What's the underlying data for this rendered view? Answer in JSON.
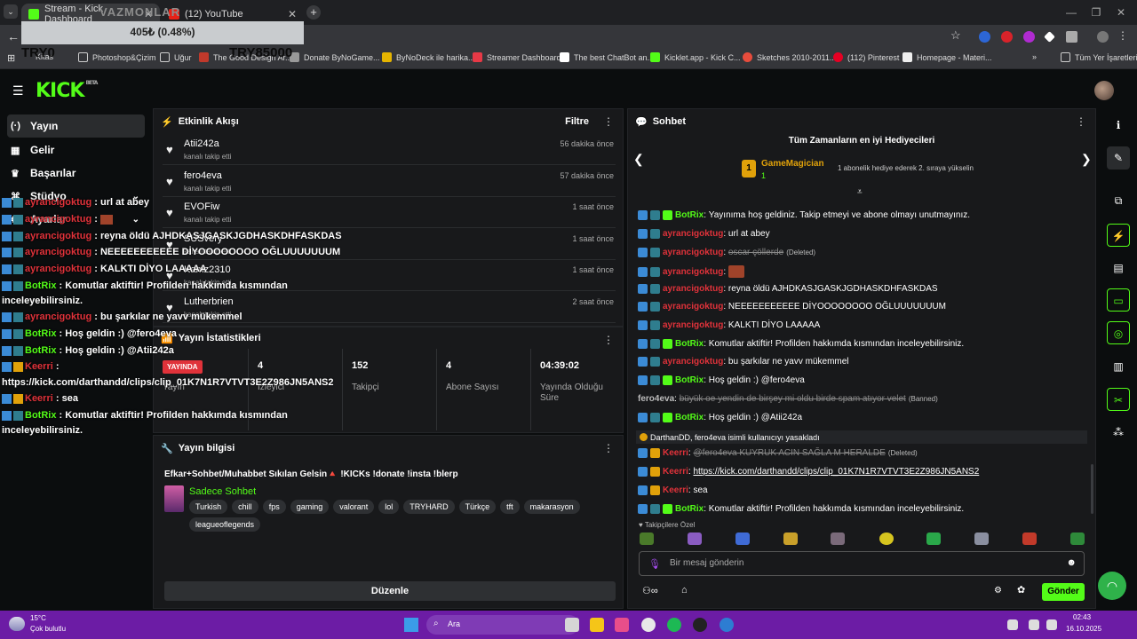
{
  "browser": {
    "tabs": [
      {
        "label": "Stream - Kick Dashboard",
        "close": "✕"
      },
      {
        "label": "(12) YouTube",
        "close": "✕"
      }
    ],
    "new_tab": "+",
    "bookmarks": [
      "Kitas",
      "Photoshop&Çizim",
      "Uğur",
      "The Good Design Ar...",
      "Donate ByNoGame...",
      "ByNoDeck ile harika...",
      "Streamer Dashboard",
      "The best ChatBot an...",
      "Kicklet.app - Kick C...",
      "Sketches 2010-2011...",
      "(112) Pinterest",
      "Homepage - Materi..."
    ],
    "all_bookmarks": "Tüm Yer İşaretleri",
    "more_bookmarks": "»"
  },
  "overlay": {
    "donation": "405₺ (0.48%)",
    "ghost_text": "VAZMONLAR",
    "try_left": "TRY0",
    "try_right": "TRY85000"
  },
  "header": {
    "logo": "KICK",
    "beta": "BETA"
  },
  "sidebar": {
    "items": [
      {
        "label": "Yayın",
        "icon": "broadcast-icon",
        "glyph": "(·)"
      },
      {
        "label": "Gelir",
        "icon": "money-icon",
        "glyph": "▦"
      },
      {
        "label": "Başarılar",
        "icon": "trophy-icon",
        "glyph": "♛"
      },
      {
        "label": "Stüdyo",
        "icon": "studio-icon",
        "glyph": "⌘"
      },
      {
        "label": "Ayarlar",
        "icon": "gear-icon",
        "glyph": "⚙"
      }
    ]
  },
  "activity": {
    "title": "Etkinlik Akışı",
    "filter": "Filtre",
    "items": [
      {
        "name": "Atii242a",
        "action": "kanalı takip etti",
        "time": "56 dakika önce"
      },
      {
        "name": "fero4eva",
        "action": "kanalı takip etti",
        "time": "57 dakika önce"
      },
      {
        "name": "EVOFiw",
        "action": "kanalı takip etti",
        "time": "1 saat önce"
      },
      {
        "name": "SUSvery",
        "action": "kanalı takip etti",
        "time": "1 saat önce"
      },
      {
        "name": "Kamz2310",
        "action": "kanalı takip etti",
        "time": "1 saat önce"
      },
      {
        "name": "Lutherbrien",
        "action": "kanalı takip etti",
        "time": "2 saat önce"
      }
    ]
  },
  "stats": {
    "title": "Yayın İstatistikleri",
    "live_badge": "YAYINDA",
    "cells": [
      {
        "value": "4",
        "label": "İzleyici"
      },
      {
        "value": "152",
        "label": "Takipçi"
      },
      {
        "value": "4",
        "label": "Abone Sayısı"
      },
      {
        "value": "04:39:02",
        "label": "Yayında Olduğu Süre"
      }
    ],
    "first_label": "Yayın"
  },
  "stream_info": {
    "title": "Yayın bilgisi",
    "stream_title": "Efkar+Sohbet/Muhabbet Sıkılan Gelsin🔺 !KICKs !donate !insta !blerp",
    "category": "Sadece Sohbet",
    "tags": [
      "Turkish",
      "chill",
      "fps",
      "gaming",
      "valorant",
      "lol",
      "TRYHARD",
      "Türkçe",
      "tft",
      "makarasyon",
      "leagueoflegends"
    ],
    "edit": "Düzenle"
  },
  "chat": {
    "title": "Sohbet",
    "gifters_title": "Tüm Zamanların en iyi Hediyecileri",
    "top_gifter": {
      "rank": "1",
      "name": "GameMagician",
      "count": "1",
      "note": "1 abonelik hediye ederek 2. sıraya yükselin"
    },
    "messages": [
      {
        "user": "BotRix",
        "type": "bot",
        "text": "Yayınıma hoş geldiniz. Takip etmeyi ve abone olmayı unutmayınız."
      },
      {
        "user": "ayrancigoktug",
        "type": "mod",
        "text": "url at abey"
      },
      {
        "user": "ayrancigoktug",
        "type": "mod",
        "text": "oscar çöllerde",
        "deleted": "(Deleted)"
      },
      {
        "user": "ayrancigoktug",
        "type": "mod",
        "text": "",
        "emote": true
      },
      {
        "user": "ayrancigoktug",
        "type": "mod",
        "text": "reyna öldü AJHDKASJGASKJGDHASKDHFASKDAS"
      },
      {
        "user": "ayrancigoktug",
        "type": "mod",
        "text": "NEEEEEEEEEEE DİYOOOOOOOO OĞLUUUUUUUM"
      },
      {
        "user": "ayrancigoktug",
        "type": "mod",
        "text": "KALKTI DİYO LAAAAA"
      },
      {
        "user": "BotRix",
        "type": "bot",
        "text": "Komutlar aktiftir! Profilden hakkımda kısmından inceleyebilirsiniz."
      },
      {
        "user": "ayrancigoktug",
        "type": "mod",
        "text": "bu şarkılar ne yavv mükemmel"
      },
      {
        "user": "BotRix",
        "type": "bot",
        "text": "Hoş geldin :) @fero4eva"
      },
      {
        "user": "fero4eva",
        "type": "banned",
        "text": "büyük oe yendin de birşey mi oldu birde spam atıyor velet",
        "deleted": "(Banned)"
      },
      {
        "user": "BotRix",
        "type": "bot",
        "text": "Hoş geldin :) @Atii242a"
      },
      {
        "user": "",
        "type": "system",
        "text": "DarthanDD, fero4eva isimli kullanıcıyı yasakladı"
      },
      {
        "user": "Keerri",
        "type": "owner",
        "text": "@fero4eva KUYRUK ACIN SAĞLA M HERALDE",
        "deleted": "(Deleted)"
      },
      {
        "user": "Keerri",
        "type": "owner",
        "text": "https://kick.com/darthandd/clips/clip_01K7N1R7VTVT3E2Z986JN5ANS2",
        "link": true
      },
      {
        "user": "Keerri",
        "type": "owner",
        "text": "sea"
      },
      {
        "user": "BotRix",
        "type": "bot",
        "text": "Komutlar aktiftir! Profilden hakkımda kısmından inceleyebilirsiniz."
      }
    ],
    "followers_only": "Takipçilere Özel",
    "input_placeholder": "Bir mesaj gönderin",
    "send": "Gönder"
  },
  "overlay_chat": [
    {
      "user": "ayrancigoktug",
      "text": "url at abey"
    },
    {
      "user": "ayrancigoktug",
      "text": ""
    },
    {
      "user": "ayrancigoktug",
      "text": "reyna öldü AJHDKASJGASKJGDHASKDHFASKDAS"
    },
    {
      "user": "ayrancigoktug",
      "text": "NEEEEEEEEEEE DİYOOOOOOOO OĞLUUUUUUUM"
    },
    {
      "user": "ayrancigoktug",
      "text": "KALKTI DİYO LAAAAA"
    },
    {
      "user": "BotRix",
      "text": "Komutlar aktiftir! Profilden hakkımda kısmından"
    },
    {
      "user": "",
      "text": "inceleyebilirsiniz."
    },
    {
      "user": "ayrancigoktug",
      "text": "bu şarkılar ne yavv mükemmel"
    },
    {
      "user": "BotRix",
      "text": "Hoş geldin :) @fero4eva"
    },
    {
      "user": "BotRix",
      "text": "Hoş geldin :) @Atii242a"
    },
    {
      "user": "Keerri",
      "text": ""
    },
    {
      "user": "",
      "text": "https://kick.com/darthandd/clips/clip_01K7N1R7VTVT3E2Z986JN5ANS2"
    },
    {
      "user": "Keerri",
      "text": "sea"
    },
    {
      "user": "BotRix",
      "text": "Komutlar aktiftir! Profilden hakkımda kısmından"
    },
    {
      "user": "",
      "text": "inceleyebilirsiniz."
    }
  ],
  "taskbar": {
    "temp": "15°C",
    "weather": "Çok bulutlu",
    "search": "Ara",
    "time": "02:43",
    "date": "16.10.2025"
  },
  "colors": {
    "kick_green": "#53fc18",
    "taskbar": "#6c1ca5",
    "mod_red": "#e0323a"
  }
}
